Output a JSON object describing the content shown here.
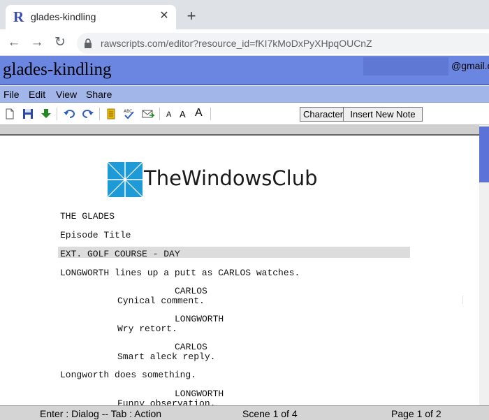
{
  "browser": {
    "tab_title": "glades-kindling",
    "tab_favicon": "R",
    "url": "rawscripts.com/editor?resource_id=fKI7kMoDxPyXHpqOUCnZ"
  },
  "app": {
    "doc_title": "glades-kindling",
    "account": "@gmail.c"
  },
  "menu": [
    "File",
    "Edit",
    "View",
    "Share"
  ],
  "toolbar": {
    "icons": [
      "new-document-icon",
      "save-icon",
      "download-icon",
      "undo-icon",
      "redo-icon",
      "notes-icon",
      "spellcheck-icon",
      "email-icon"
    ],
    "font_sizes": [
      "A",
      "A",
      "A"
    ],
    "element_select": "Character",
    "insert_note_label": "Insert New Note"
  },
  "watermark": "TheWindowsClub",
  "script_lines": [
    "THE GLADES",
    "Episode Title",
    "EXT. GOLF COURSE - DAY",
    "LONGWORTH lines up a putt as CARLOS watches.",
    "CARLOS",
    "Cynical comment.",
    "LONGWORTH",
    "Wry retort.",
    "CARLOS",
    "Smart aleck reply.",
    "Longworth does something.",
    "LONGWORTH",
    "Funny observation."
  ],
  "status": {
    "hint": "Enter : Dialog -- Tab : Action",
    "scene": "Scene 1 of 4",
    "page": "Page 1 of 2"
  },
  "colors": {
    "header": "#6b86e0",
    "menubar": "#a3b6ea",
    "scrollbar": "#5b73d8"
  }
}
